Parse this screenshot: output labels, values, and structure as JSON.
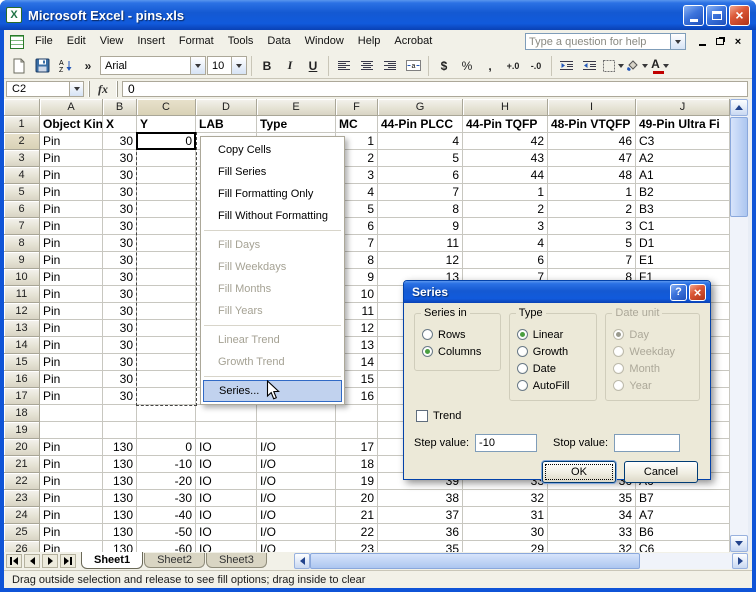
{
  "window": {
    "title": "Microsoft Excel - pins.xls",
    "icon_letter": "X",
    "close_glyph": "×"
  },
  "menubar": {
    "items": [
      "File",
      "Edit",
      "View",
      "Insert",
      "Format",
      "Tools",
      "Data",
      "Window",
      "Help",
      "Acrobat"
    ],
    "question_box": "Type a question for help",
    "close_glyph": "×"
  },
  "toolbar": {
    "font_name": "Arial",
    "font_size": "10",
    "overflow": "»",
    "bold": "B",
    "italic": "I",
    "underline": "U",
    "currency": "$",
    "percent": "%",
    "comma": ",",
    "increase_decimal": "+.0",
    "decrease_decimal": "-.0",
    "font_color_letter": "A"
  },
  "formula_bar": {
    "name_box": "C2",
    "fx_label": "fx",
    "value": "0"
  },
  "grid": {
    "columns": [
      "A",
      "B",
      "C",
      "D",
      "E",
      "F",
      "G",
      "H",
      "I",
      "J"
    ],
    "rows": [
      {
        "n": 1,
        "bold": true,
        "cells": {
          "A": "Object Kind",
          "B": "X",
          "C": "Y",
          "D": "LAB",
          "E": "Type",
          "F": "MC",
          "G": "44-Pin PLCC",
          "H": "44-Pin TQFP",
          "I": "48-Pin VTQFP",
          "J": "49-Pin Ultra Fi"
        }
      },
      {
        "n": 2,
        "cells": {
          "A": "Pin",
          "B": "30",
          "C": "0",
          "F": "1",
          "G": "4",
          "H": "42",
          "I": "46",
          "J": "C3"
        }
      },
      {
        "n": 3,
        "cells": {
          "A": "Pin",
          "B": "30",
          "F": "2",
          "G": "5",
          "H": "43",
          "I": "47",
          "J": "A2"
        }
      },
      {
        "n": 4,
        "cells": {
          "A": "Pin",
          "B": "30",
          "F": "3",
          "G": "6",
          "H": "44",
          "I": "48",
          "J": "A1"
        }
      },
      {
        "n": 5,
        "cells": {
          "A": "Pin",
          "B": "30",
          "F": "4",
          "G": "7",
          "H": "1",
          "I": "1",
          "J": "B2"
        }
      },
      {
        "n": 6,
        "cells": {
          "A": "Pin",
          "B": "30",
          "F": "5",
          "G": "8",
          "H": "2",
          "I": "2",
          "J": "B3"
        }
      },
      {
        "n": 7,
        "cells": {
          "A": "Pin",
          "B": "30",
          "F": "6",
          "G": "9",
          "H": "3",
          "I": "3",
          "J": "C1"
        }
      },
      {
        "n": 8,
        "cells": {
          "A": "Pin",
          "B": "30",
          "F": "7",
          "G": "11",
          "H": "4",
          "I": "5",
          "J": "D1"
        }
      },
      {
        "n": 9,
        "cells": {
          "A": "Pin",
          "B": "30",
          "F": "8",
          "G": "12",
          "H": "6",
          "I": "7",
          "J": "E1"
        }
      },
      {
        "n": 10,
        "cells": {
          "A": "Pin",
          "B": "30",
          "F": "9",
          "G": "13",
          "H": "7",
          "I": "8",
          "J": "F1"
        }
      },
      {
        "n": 11,
        "cells": {
          "A": "Pin",
          "B": "30",
          "F": "10"
        }
      },
      {
        "n": 12,
        "cells": {
          "A": "Pin",
          "B": "30",
          "F": "11"
        }
      },
      {
        "n": 13,
        "cells": {
          "A": "Pin",
          "B": "30",
          "F": "12"
        }
      },
      {
        "n": 14,
        "cells": {
          "A": "Pin",
          "B": "30",
          "F": "13"
        }
      },
      {
        "n": 15,
        "cells": {
          "A": "Pin",
          "B": "30",
          "F": "14"
        }
      },
      {
        "n": 16,
        "cells": {
          "A": "Pin",
          "B": "30",
          "F": "15"
        }
      },
      {
        "n": 17,
        "cells": {
          "A": "Pin",
          "B": "30",
          "F": "16"
        }
      },
      {
        "n": 18,
        "cells": {}
      },
      {
        "n": 19,
        "cells": {}
      },
      {
        "n": 20,
        "cells": {
          "A": "Pin",
          "B": "130",
          "C": "0",
          "D": "IO",
          "E": "I/O",
          "F": "17"
        }
      },
      {
        "n": 21,
        "cells": {
          "A": "Pin",
          "B": "130",
          "C": "-10",
          "D": "IO",
          "E": "I/O",
          "F": "18"
        }
      },
      {
        "n": 22,
        "cells": {
          "A": "Pin",
          "B": "130",
          "C": "-20",
          "D": "IO",
          "E": "I/O",
          "F": "19",
          "G": "39",
          "H": "33",
          "I": "36",
          "J": "A6"
        }
      },
      {
        "n": 23,
        "cells": {
          "A": "Pin",
          "B": "130",
          "C": "-30",
          "D": "IO",
          "E": "I/O",
          "F": "20",
          "G": "38",
          "H": "32",
          "I": "35",
          "J": "B7"
        }
      },
      {
        "n": 24,
        "cells": {
          "A": "Pin",
          "B": "130",
          "C": "-40",
          "D": "IO",
          "E": "I/O",
          "F": "21",
          "G": "37",
          "H": "31",
          "I": "34",
          "J": "A7"
        }
      },
      {
        "n": 25,
        "cells": {
          "A": "Pin",
          "B": "130",
          "C": "-50",
          "D": "IO",
          "E": "I/O",
          "F": "22",
          "G": "36",
          "H": "30",
          "I": "33",
          "J": "B6"
        }
      },
      {
        "n": 26,
        "cells": {
          "A": "Pin",
          "B": "130",
          "C": "-60",
          "D": "IO",
          "E": "I/O",
          "F": "23",
          "G": "35",
          "H": "29",
          "I": "32",
          "J": "C6"
        }
      }
    ]
  },
  "context_menu": {
    "items": [
      {
        "label": "Copy Cells",
        "enabled": true
      },
      {
        "label": "Fill Series",
        "enabled": true
      },
      {
        "label": "Fill Formatting Only",
        "enabled": true
      },
      {
        "label": "Fill Without Formatting",
        "enabled": true
      },
      {
        "separator": true
      },
      {
        "label": "Fill Days",
        "enabled": false
      },
      {
        "label": "Fill Weekdays",
        "enabled": false
      },
      {
        "label": "Fill Months",
        "enabled": false
      },
      {
        "label": "Fill Years",
        "enabled": false
      },
      {
        "separator": true
      },
      {
        "label": "Linear Trend",
        "enabled": false
      },
      {
        "label": "Growth Trend",
        "enabled": false
      },
      {
        "separator": true
      },
      {
        "label": "Series...",
        "enabled": true,
        "selected": true
      }
    ]
  },
  "dialog": {
    "title": "Series",
    "help_glyph": "?",
    "close_glyph": "×",
    "groups": [
      {
        "legend": "Series in",
        "disabled": false,
        "options": [
          {
            "label": "Rows",
            "checked": false
          },
          {
            "label": "Columns",
            "checked": true
          }
        ]
      },
      {
        "legend": "Type",
        "disabled": false,
        "options": [
          {
            "label": "Linear",
            "checked": true
          },
          {
            "label": "Growth",
            "checked": false
          },
          {
            "label": "Date",
            "checked": false
          },
          {
            "label": "AutoFill",
            "checked": false
          }
        ]
      },
      {
        "legend": "Date unit",
        "disabled": true,
        "options": [
          {
            "label": "Day",
            "checked": true
          },
          {
            "label": "Weekday",
            "checked": false
          },
          {
            "label": "Month",
            "checked": false
          },
          {
            "label": "Year",
            "checked": false
          }
        ]
      }
    ],
    "trend_label": "Trend",
    "step_label": "Step value:",
    "step_value": "-10",
    "stop_label": "Stop value:",
    "stop_value": "",
    "ok_label": "OK",
    "cancel_label": "Cancel"
  },
  "sheet_tabs": [
    {
      "label": "Sheet1",
      "active": true
    },
    {
      "label": "Sheet2",
      "active": false
    },
    {
      "label": "Sheet3",
      "active": false
    }
  ],
  "status_bar": {
    "text": "Drag outside selection and release to see fill options; drag inside to clear"
  }
}
